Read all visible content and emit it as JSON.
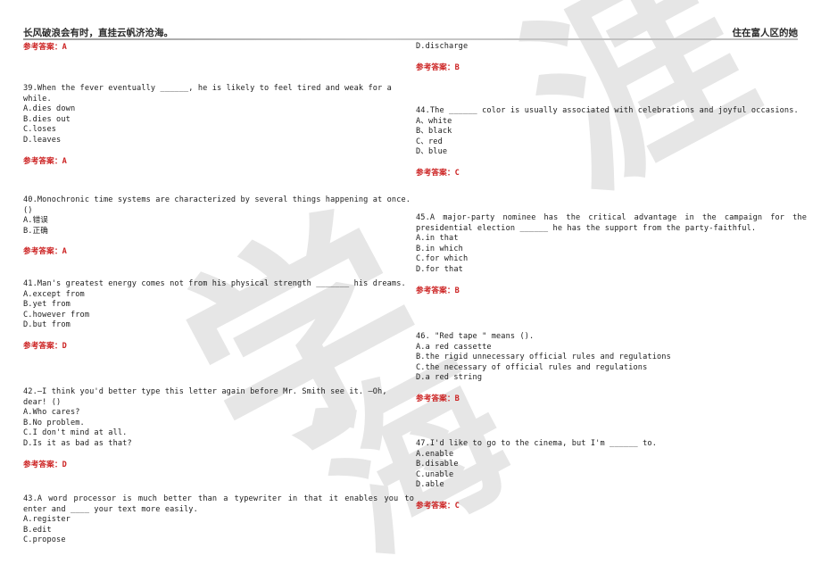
{
  "header": {
    "left_text": "长风破浪会有时，直挂云帆济沧海。",
    "right_text": "住在富人区的她"
  },
  "watermark": {
    "char_1": "涯",
    "char_2": "学",
    "char_3": "海"
  },
  "answer_label": "参考答案",
  "colors": {
    "answer_red": "#cc2222",
    "body_text": "#1c1c1c",
    "watermark_gray": "#e6e6e6",
    "rule_gray": "#9a9a9a"
  },
  "left_column": [
    {
      "id": "answer-carryover-38",
      "type": "carryover",
      "options": [
        "A.dies down"
      ],
      "answer": "参考答案：A",
      "answer_letter": "A"
    },
    {
      "id": "question-39",
      "type": "question",
      "number": "39.",
      "stem": "39.When the fever eventually ______, he is likely to feel tired and weak for a while.",
      "options": [
        "A.dies down",
        "B.dies out",
        "C.loses",
        "D.leaves"
      ],
      "answer": "参考答案：A",
      "answer_letter": "A"
    },
    {
      "id": "question-40",
      "type": "question",
      "number": "40.",
      "stem": "40.Monochronic time systems are characterized by several things happening at once. ()",
      "options": [
        "A.错误",
        "B.正确"
      ],
      "answer": "参考答案：A",
      "answer_letter": "A"
    },
    {
      "id": "question-41",
      "type": "question",
      "number": "41.",
      "stem": "41.Man's greatest energy comes not from his physical strength _______ his dreams.",
      "options": [
        "A.except from",
        "B.yet from",
        "C.however from",
        "D.but from"
      ],
      "answer": "参考答案：D",
      "answer_letter": "D"
    },
    {
      "id": "question-42",
      "type": "question",
      "number": "42.",
      "stem": "42.—I think you'd better type this letter again before Mr. Smith see it. —Oh, dear! ()",
      "options": [
        "A.Who cares?",
        "B.No problem.",
        "C.I don't mind at all.",
        "D.Is it as bad as that?"
      ],
      "answer": "参考答案：D",
      "answer_letter": "D"
    },
    {
      "id": "question-43",
      "type": "question",
      "number": "43.",
      "stem": "43.A word processor is much better than a typewriter in that it enables you to enter and ____ your text more easily.",
      "options": [
        "A.register",
        "B.edit",
        "C.propose"
      ],
      "answer": "",
      "answer_letter": ""
    }
  ],
  "right_column": [
    {
      "id": "answer-carryover-43",
      "type": "carryover",
      "options": [
        "D.discharge"
      ],
      "answer": "参考答案：B",
      "answer_letter": "B"
    },
    {
      "id": "question-44",
      "type": "question",
      "number": "44.",
      "stem": "44.The ______ color is usually associated with celebrations and joyful occasions.",
      "options": [
        "A、white",
        "B、black",
        "C、red",
        "D、blue"
      ],
      "answer": "参考答案：C",
      "answer_letter": "C"
    },
    {
      "id": "question-45",
      "type": "question",
      "number": "45.",
      "stem": "45.A major-party nominee has the critical advantage in the campaign for the presidential election ______ he has the support from the party-faithful.",
      "options": [
        "A.in that",
        "B.in which",
        "C.for which",
        "D.for that"
      ],
      "answer": "参考答案：B",
      "answer_letter": "B"
    },
    {
      "id": "question-46",
      "type": "question",
      "number": "46.",
      "stem": "46. \"Red tape \" means ().",
      "options": [
        "A.a red cassette",
        "B.the rigid unnecessary official rules and regulations",
        "C.the necessary of official rules and regulations",
        "D.a red string"
      ],
      "answer": "参考答案：B",
      "answer_letter": "B"
    },
    {
      "id": "question-47",
      "type": "question",
      "number": "47.",
      "stem": "47.I'd like to go to the cinema, but I'm ______ to.",
      "options": [
        "A.enable",
        "B.disable",
        "C.unable",
        "D.able"
      ],
      "answer": "参考答案：C",
      "answer_letter": "C"
    }
  ],
  "layout": {
    "left_tops": [
      48,
      94,
      219,
      313,
      434,
      554
    ],
    "right_tops": [
      47,
      119,
      239,
      372,
      492
    ]
  }
}
